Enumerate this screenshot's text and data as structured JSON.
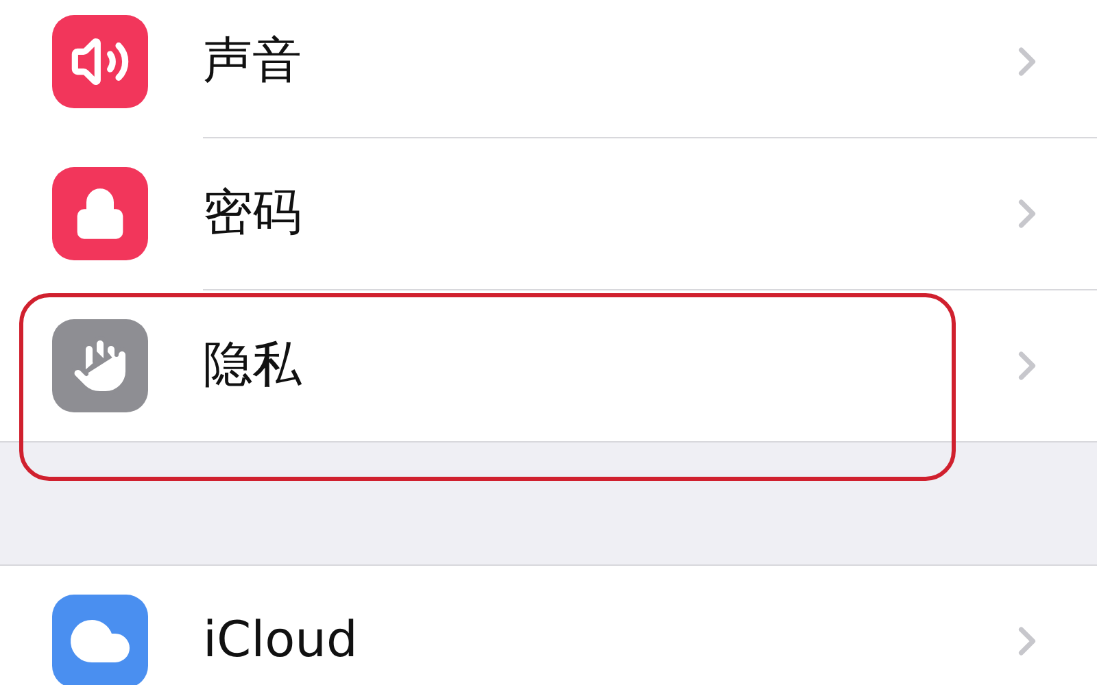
{
  "groups": [
    {
      "items": [
        {
          "label": "声音",
          "kind": "sound",
          "color": "#f2365b",
          "highlighted": false
        },
        {
          "label": "密码",
          "kind": "lock",
          "color": "#f2365b",
          "highlighted": false
        },
        {
          "label": "隐私",
          "kind": "hand",
          "color": "#8e8e93",
          "highlighted": true
        }
      ]
    },
    {
      "items": [
        {
          "label": "iCloud",
          "kind": "cloud",
          "color": "#4a8ff0",
          "highlighted": false
        }
      ]
    }
  ]
}
